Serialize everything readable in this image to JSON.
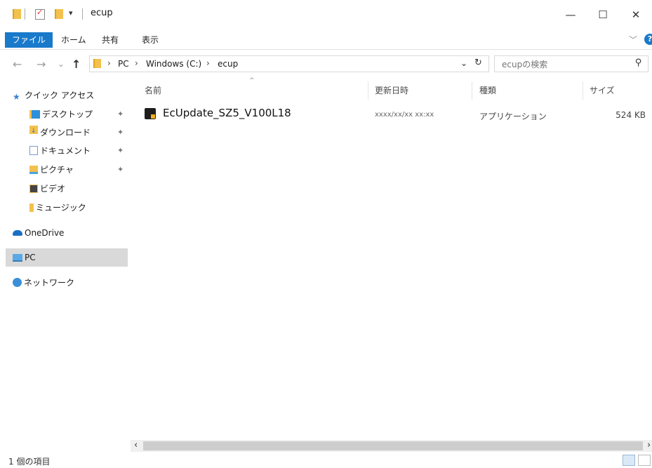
{
  "window": {
    "title": "ecup",
    "qa_toolbar_dropdown": "▾",
    "controls": {
      "minimize": "—",
      "maximize": "☐",
      "close": "✕"
    }
  },
  "ribbon": {
    "tabs": [
      "ファイル",
      "ホーム",
      "共有",
      "表示"
    ],
    "expand": "﹀",
    "help": "?"
  },
  "nav": {
    "back": "←",
    "forward": "→",
    "recent": "⌄",
    "up": "↑",
    "breadcrumbs": [
      "PC",
      "Windows (C:)",
      "ecup"
    ],
    "crumb_sep": "›",
    "address_dropdown": "⌄",
    "refresh": "↻",
    "search_placeholder": "ecupの検索",
    "search_icon": "⚲"
  },
  "sidebar": {
    "quick_access": "クイック アクセス",
    "items": [
      {
        "label": "デスクトップ",
        "pinned": true
      },
      {
        "label": "ダウンロード",
        "pinned": true
      },
      {
        "label": "ドキュメント",
        "pinned": true
      },
      {
        "label": "ピクチャ",
        "pinned": true
      },
      {
        "label": "ビデオ",
        "pinned": false
      },
      {
        "label": "ミュージック",
        "pinned": false
      }
    ],
    "onedrive": "OneDrive",
    "pc": "PC",
    "network": "ネットワーク",
    "pin_glyph": "✦"
  },
  "list": {
    "sort_indicator": "^",
    "headers": {
      "name": "名前",
      "modified": "更新日時",
      "type": "種類",
      "size": "サイズ"
    },
    "files": [
      {
        "icon": "ec-app-icon",
        "name": "EcUpdate_SZ5_V100L18",
        "modified": "xxxx/xx/xx xx:xx",
        "type": "アプリケーション",
        "size": "524 KB"
      }
    ]
  },
  "scroll": {
    "left": "‹",
    "right": "›"
  },
  "status": {
    "item_count": "1 個の項目"
  },
  "colors": {
    "accent": "#1979ca",
    "selection": "#d9d9d9",
    "folder": "#f2c14e"
  }
}
